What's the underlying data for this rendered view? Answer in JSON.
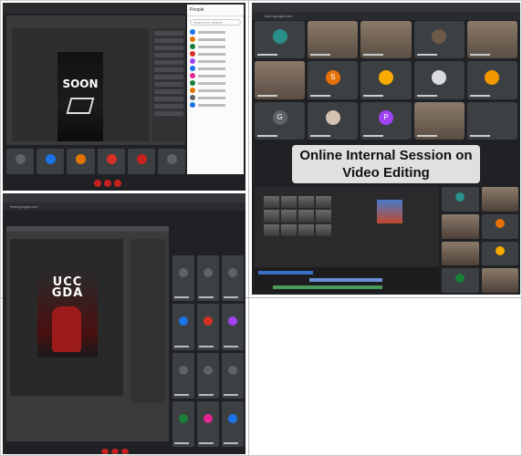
{
  "panel_top_left": {
    "poster_text": "SOON",
    "people_header": "People",
    "search_placeholder": "Search for people",
    "tile_colors": [
      "#5f6368",
      "#1a73e8",
      "#e37400",
      "#d93025",
      "#c5221f",
      "#5f6368"
    ]
  },
  "panel_bottom_left": {
    "url_text": "meet.google.com",
    "poster_text": "UCC GDA",
    "cell_colors": [
      "#5f6368",
      "#5f6368",
      "#5f6368",
      "#1a73e8",
      "#d93025",
      "#a142f4",
      "#5f6368",
      "#5f6368",
      "#5f6368",
      "#188038",
      "#e52592",
      "#1a73e8"
    ]
  },
  "panel_top_right": {
    "url_text": "meet.google.com",
    "caption_line1": "Online Internal Session on",
    "caption_line2": "Video Editing",
    "tile_letters": [
      "",
      "",
      "",
      "",
      "",
      "",
      "S",
      "",
      "",
      "",
      "G",
      "",
      "P",
      "",
      ""
    ],
    "tile_colors": [
      "#5f6368",
      "#5f6368",
      "#5f6368",
      "#5f6368",
      "#5f6368",
      "#5f6368",
      "#e8710a",
      "#5f6368",
      "#5f6368",
      "#5f6368",
      "#5f6368",
      "#5f6368",
      "#a142f4",
      "#5f6368",
      "#5f6368"
    ]
  }
}
